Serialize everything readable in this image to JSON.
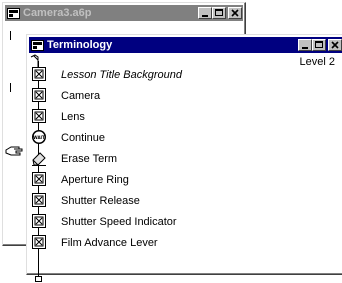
{
  "back_window": {
    "title": "Camera3.a6p",
    "icon": "authorware-file-icon",
    "buttons": [
      "minimize-icon",
      "maximize-icon",
      "close-icon"
    ]
  },
  "front_window": {
    "title": "Terminology",
    "icon": "authorware-file-icon",
    "buttons": [
      "minimize-icon",
      "maximize-icon",
      "close-icon"
    ],
    "level": "Level 2",
    "flow_items": [
      {
        "label": "Lesson Title Background",
        "icon": "display-icon",
        "italic": true
      },
      {
        "label": "Camera",
        "icon": "display-icon",
        "italic": false
      },
      {
        "label": "Lens",
        "icon": "display-icon",
        "italic": false
      },
      {
        "label": "Continue",
        "icon": "wait-icon",
        "italic": false
      },
      {
        "label": "Erase Term",
        "icon": "erase-icon",
        "italic": false
      },
      {
        "label": "Aperture Ring",
        "icon": "display-icon",
        "italic": false
      },
      {
        "label": "Shutter Release",
        "icon": "display-icon",
        "italic": false
      },
      {
        "label": "Shutter Speed Indicator",
        "icon": "display-icon",
        "italic": false
      },
      {
        "label": "Film Advance Lever",
        "icon": "display-icon",
        "italic": false
      }
    ],
    "wait_icon_text": "WAIT",
    "paste_hand": "hand-pointer-icon"
  },
  "colors": {
    "active_title": "#000080",
    "inactive_title": "#808080",
    "chrome": "#c0c0c0"
  }
}
